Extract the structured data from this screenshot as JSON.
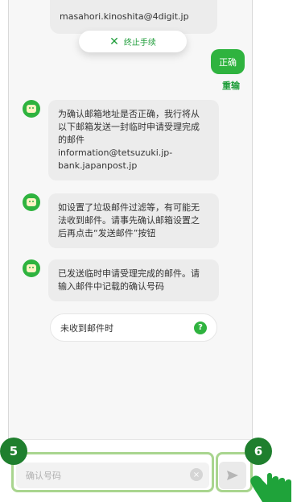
{
  "top_bubble": {
    "email_text": "masahori.kinoshita@4digit.jp"
  },
  "stop_pill": {
    "icon": "close-icon",
    "label": "终止手续"
  },
  "user_message": {
    "text": "正确"
  },
  "resend": {
    "label": "重输"
  },
  "bot_messages": [
    {
      "lines": [
        "为确认邮箱地址是否正确，我行将从",
        "以下邮箱发送一封临时申请受理完成",
        "的邮件",
        "information@tetsuzuki.jp-",
        "bank.japanpost.jp"
      ]
    },
    {
      "lines": [
        "如设置了垃圾邮件过滤等，有可能无",
        "法收到邮件。请事先确认邮箱设置之",
        "后再点击“发送邮件”按钮"
      ]
    },
    {
      "lines": [
        "已发送临时申请受理完成的邮件。请",
        "输入邮件中记载的确认号码"
      ]
    }
  ],
  "not_received": {
    "label": "未收到邮件时",
    "help_icon": "?"
  },
  "input": {
    "placeholder": "确认号码",
    "value": "",
    "clear_icon": "×"
  },
  "send_icon": "send-icon",
  "steps": {
    "five": "5",
    "six": "6"
  },
  "colors": {
    "accent": "#2fb33f",
    "badge": "#1f7f2e",
    "highlight": "#a9d58f"
  }
}
